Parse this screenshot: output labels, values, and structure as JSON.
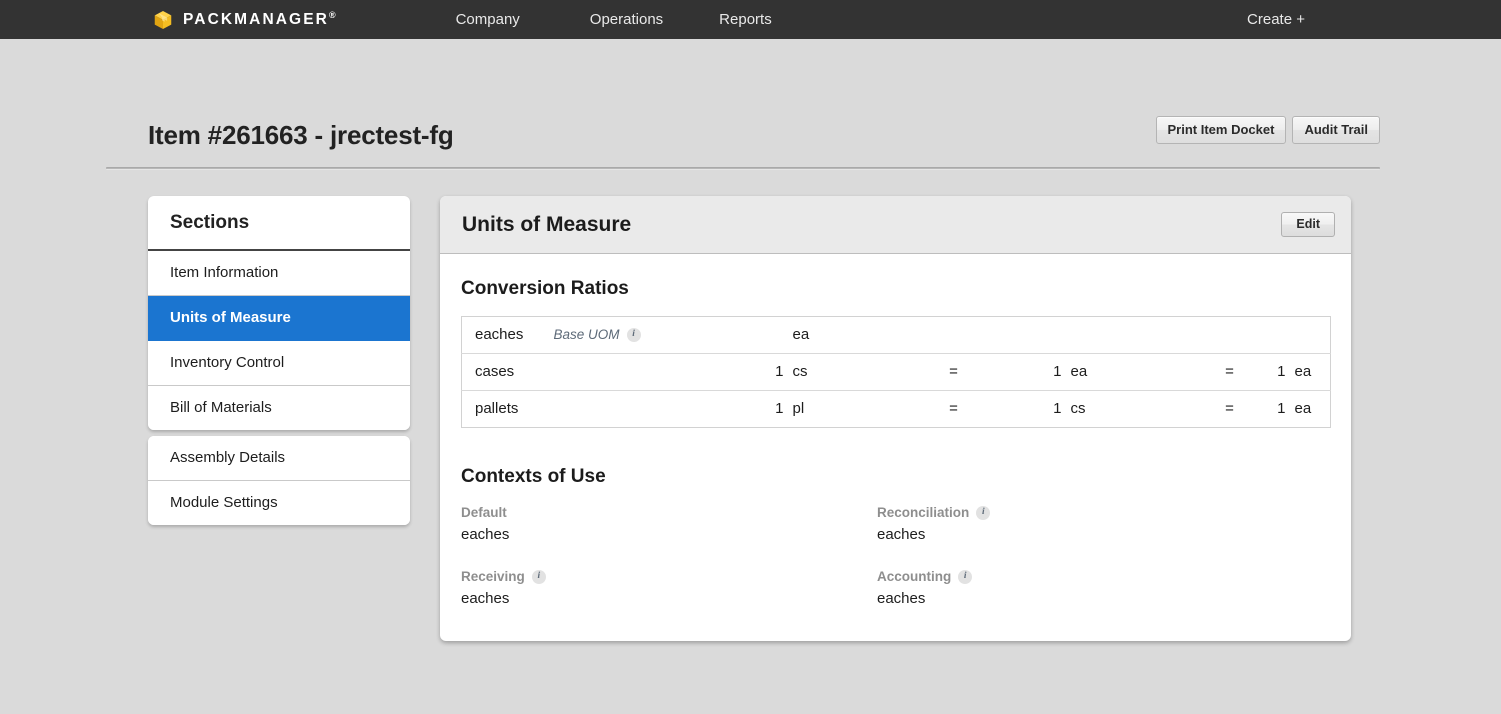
{
  "nav": {
    "brand": "PACKMANAGER",
    "brand_mark": "®",
    "brand_icon": "box-icon",
    "links": [
      {
        "label": "Company"
      },
      {
        "label": "Operations"
      },
      {
        "label": "Reports"
      }
    ],
    "create_label": "Create +"
  },
  "header": {
    "title": "Item #261663 - jrectest-fg",
    "buttons": [
      {
        "label": "Print Item Docket"
      },
      {
        "label": "Audit Trail"
      }
    ]
  },
  "sidebar": {
    "heading": "Sections",
    "groups": [
      {
        "items": [
          {
            "label": "Item Information",
            "active": false
          },
          {
            "label": "Units of Measure",
            "active": true
          },
          {
            "label": "Inventory Control",
            "active": false
          },
          {
            "label": "Bill of Materials",
            "active": false
          }
        ]
      },
      {
        "items": [
          {
            "label": "Assembly Details",
            "active": false
          },
          {
            "label": "Module Settings",
            "active": false
          }
        ]
      }
    ]
  },
  "panel": {
    "title": "Units of Measure",
    "edit_label": "Edit",
    "conversion": {
      "heading": "Conversion Ratios",
      "base_uom_label": "Base UOM",
      "rows": [
        {
          "name": "eaches",
          "is_base": true,
          "qty1": "",
          "unit1": "ea",
          "eq1": "",
          "qty2": "",
          "unit2": "",
          "eq2": "",
          "qty3": "",
          "unit3": ""
        },
        {
          "name": "cases",
          "is_base": false,
          "qty1": "1",
          "unit1": "cs",
          "eq1": "=",
          "qty2": "1",
          "unit2": "ea",
          "eq2": "=",
          "qty3": "1",
          "unit3": "ea"
        },
        {
          "name": "pallets",
          "is_base": false,
          "qty1": "1",
          "unit1": "pl",
          "eq1": "=",
          "qty2": "1",
          "unit2": "cs",
          "eq2": "=",
          "qty3": "1",
          "unit3": "ea"
        }
      ]
    },
    "contexts": {
      "heading": "Contexts of Use",
      "fields": [
        {
          "label": "Default",
          "value": "eaches",
          "has_info": false
        },
        {
          "label": "Reconciliation",
          "value": "eaches",
          "has_info": true
        },
        {
          "label": "Receiving",
          "value": "eaches",
          "has_info": true
        },
        {
          "label": "Accounting",
          "value": "eaches",
          "has_info": true
        }
      ]
    }
  },
  "colors": {
    "nav_bg": "#333333",
    "page_bg": "#dadada",
    "accent_blue": "#1b75d0",
    "brand_gold": "#f2b81e",
    "label_gray": "#8e8e8e",
    "base_uom_blue": "#5d6a78"
  },
  "icons": {
    "info": "i"
  }
}
